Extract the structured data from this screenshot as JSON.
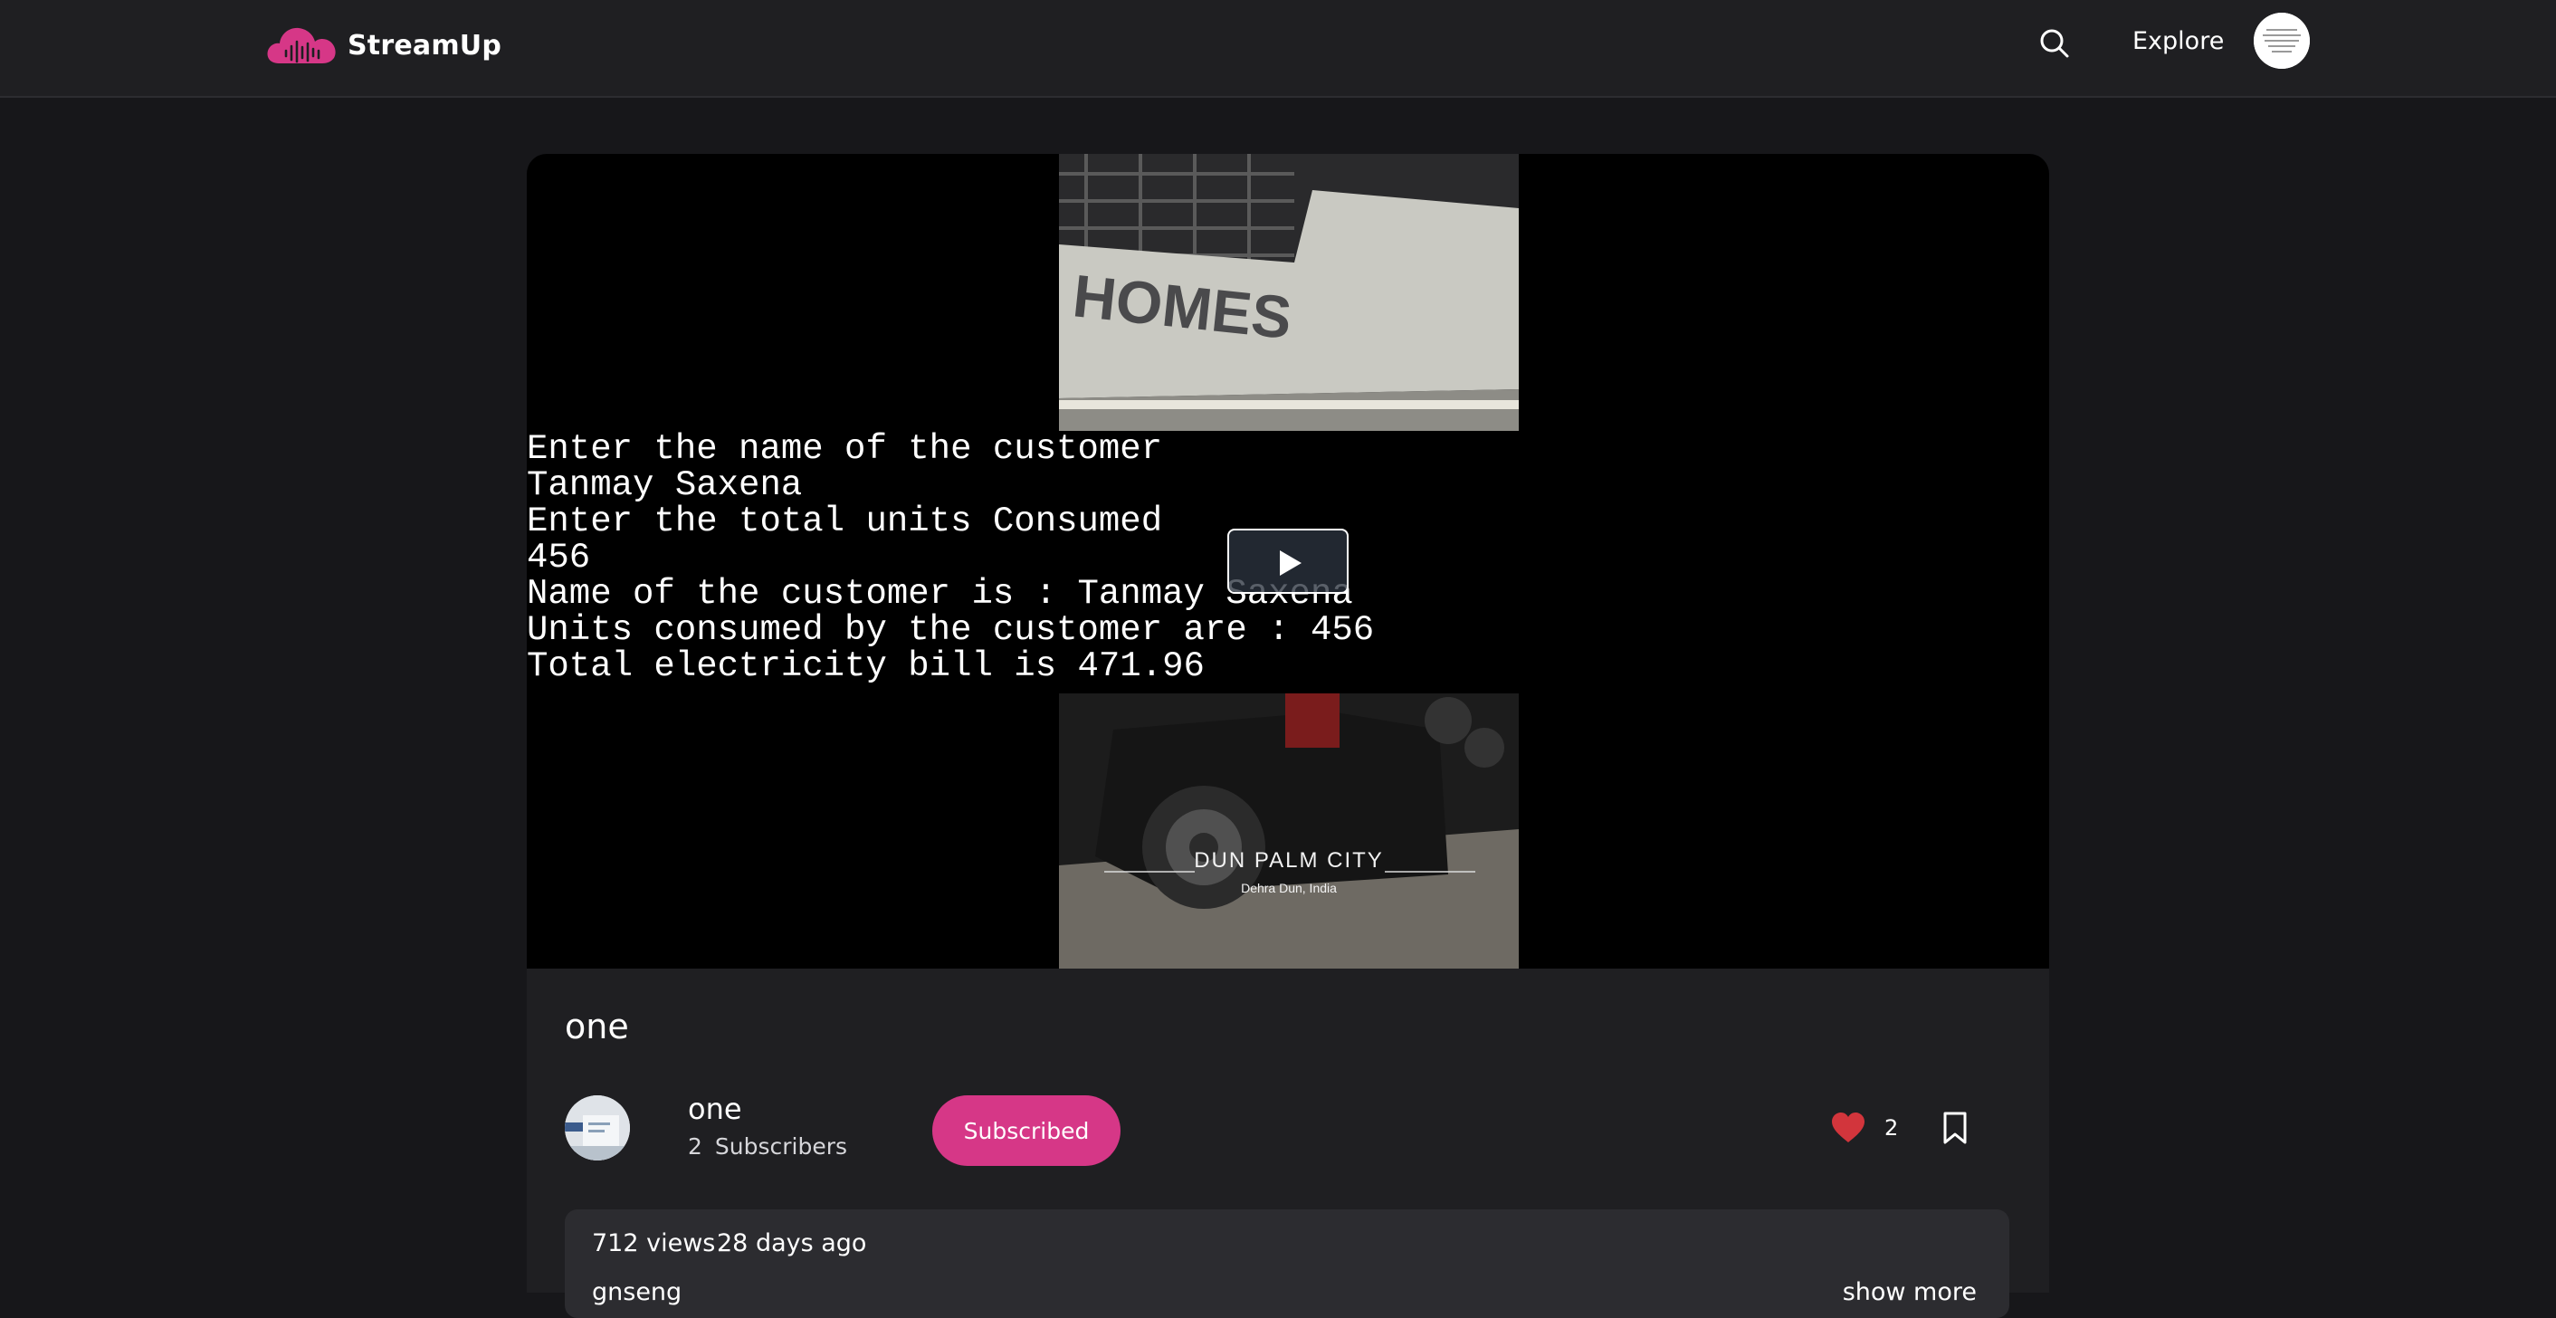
{
  "header": {
    "logo_text": "StreamUp",
    "logo_icon": "cloud-waveform-icon",
    "search_icon": "search-icon",
    "explore_label": "Explore",
    "user_avatar_icon": "user-avatar"
  },
  "player": {
    "console_lines": [
      "Enter the name of the customer",
      "Tanmay Saxena",
      "Enter the total units Consumed",
      "456",
      "Name of the customer is : Tanmay Saxena",
      "Units consumed by the customer are : 456",
      "Total electricity bill is 471.96"
    ],
    "top_sign_text": "HOMES",
    "bottom_caption": "DUN PALM CITY",
    "bottom_subcaption": "Dehra Dun, India",
    "play_icon": "play-icon"
  },
  "video": {
    "title": "one",
    "channel_name": "one",
    "subscriber_count": "2",
    "subscriber_label": "Subscribers",
    "subscribe_label": "Subscribed",
    "like_count": "2",
    "views": "712 views",
    "uploaded": "28 days ago",
    "description": "gnseng",
    "show_more_label": "show more"
  },
  "colors": {
    "accent": "#d63787",
    "background": "#17171a",
    "header": "#1f1f22",
    "panel": "#1f1f22",
    "description_box": "#2c2c30",
    "heart": "#d2353c"
  }
}
